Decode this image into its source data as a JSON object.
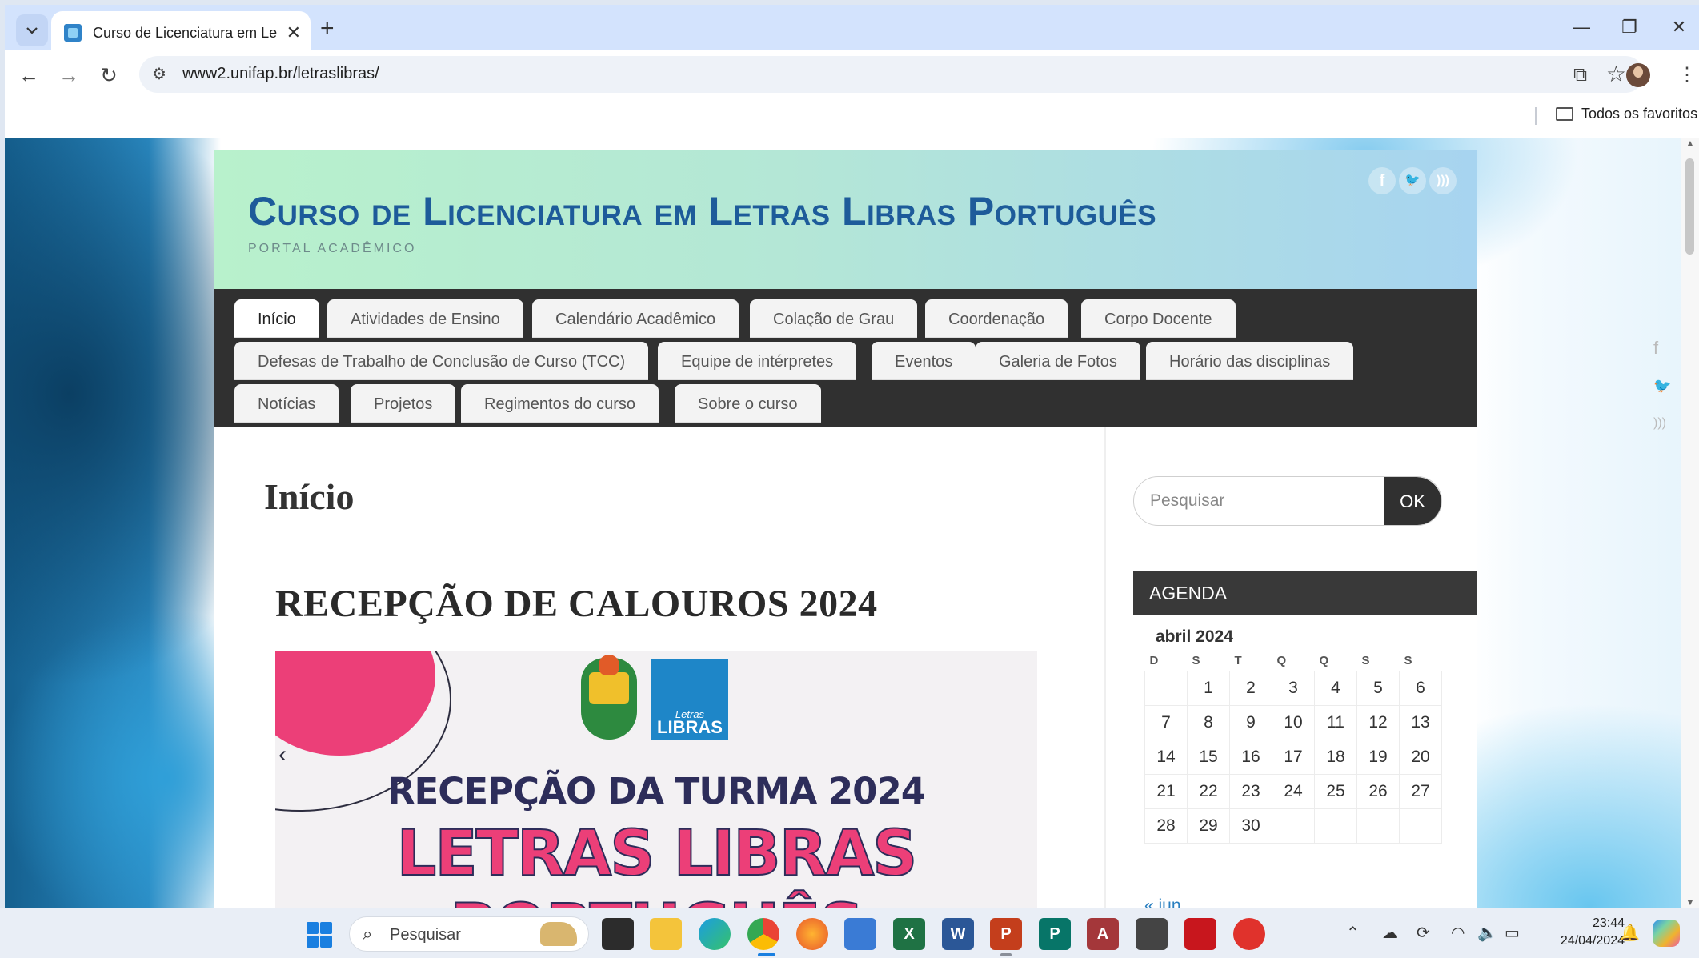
{
  "browser": {
    "tab_title": "Curso de Licenciatura em Letra",
    "tab_close": "✕",
    "new_tab": "+",
    "url": "www2.unifap.br/letraslibras/",
    "bookmarks_all": "Todos os favoritos"
  },
  "site": {
    "title": "Curso de Licenciatura em Letras Libras Português",
    "description": "PORTAL ACADÊMICO",
    "social_icons": [
      "facebook-icon",
      "twitter-icon",
      "rss-icon"
    ],
    "menu": [
      [
        "Início",
        "Atividades de Ensino",
        "Calendário Acadêmico",
        "Colação de Grau",
        "Coordenação",
        "Corpo Docente"
      ],
      [
        "Defesas de Trabalho de Conclusão de Curso (TCC)",
        "Equipe de intérpretes",
        "Eventos",
        "Galeria de Fotos",
        "Horário das disciplinas"
      ],
      [
        "Notícias",
        "Projetos",
        "Regimentos do curso",
        "Sobre o curso"
      ]
    ],
    "active_menu": "Início"
  },
  "main": {
    "page_title": "Início",
    "post_title": "RECEPÇÃO DE CALOUROS 2024",
    "banner": {
      "logo_small": "Letras",
      "logo_text": "LIBRAS",
      "line1": "RECEPÇÃO DA TURMA 2024",
      "line2": "LETRAS LIBRAS",
      "line3": "PORTUGUÊS"
    }
  },
  "sidebar": {
    "search_placeholder": "Pesquisar",
    "search_button": "OK",
    "agenda_title": "AGENDA",
    "calendar": {
      "caption": "abril 2024",
      "weekdays": [
        "D",
        "S",
        "T",
        "Q",
        "Q",
        "S",
        "S"
      ],
      "weeks": [
        [
          "",
          "1",
          "2",
          "3",
          "4",
          "5",
          "6"
        ],
        [
          "7",
          "8",
          "9",
          "10",
          "11",
          "12",
          "13"
        ],
        [
          "14",
          "15",
          "16",
          "17",
          "18",
          "19",
          "20"
        ],
        [
          "21",
          "22",
          "23",
          "24",
          "25",
          "26",
          "27"
        ],
        [
          "28",
          "29",
          "30",
          "",
          "",
          "",
          ""
        ]
      ],
      "prev_link": "« jun"
    }
  },
  "taskbar": {
    "search_label": "Pesquisar",
    "time": "23:44",
    "date": "24/04/2024"
  },
  "colors": {
    "title_blue": "#1d5b9a",
    "menu_bg": "#303030",
    "accent_pink": "#ec3f78",
    "link_blue": "#2a7fc0"
  }
}
